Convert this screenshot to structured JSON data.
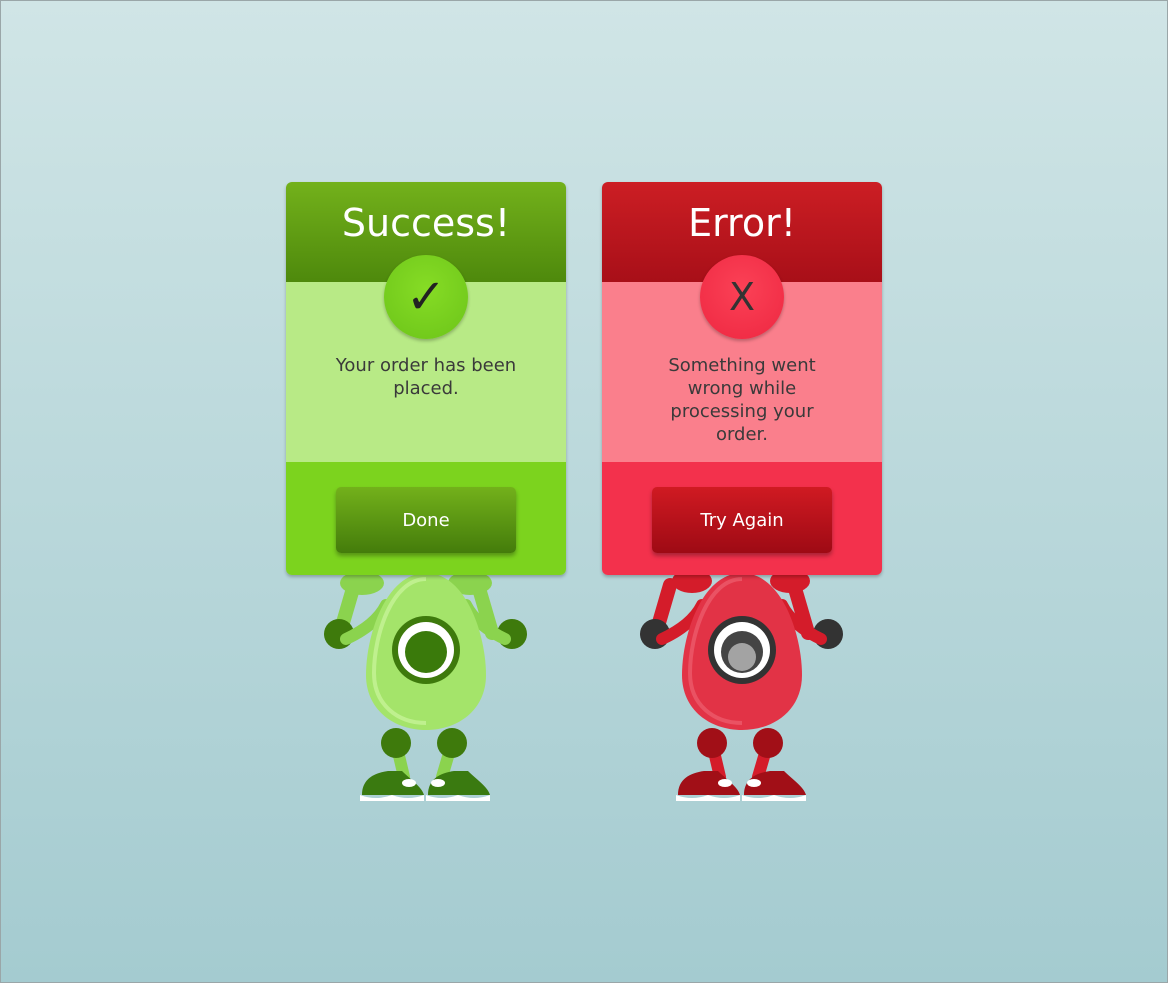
{
  "success_card": {
    "title": "Success!",
    "icon": "checkmark-icon",
    "icon_glyph": "✓",
    "message": "Your order has been placed.",
    "button_label": "Done",
    "accent_color": "#7cd31e"
  },
  "error_card": {
    "title": "Error!",
    "icon": "x-icon",
    "icon_glyph": "X",
    "message": "Something went wrong while processing your order.",
    "button_label": "Try Again",
    "accent_color": "#f3314c"
  },
  "mascots": {
    "success": "green-robot-mascot",
    "error": "red-robot-mascot"
  }
}
